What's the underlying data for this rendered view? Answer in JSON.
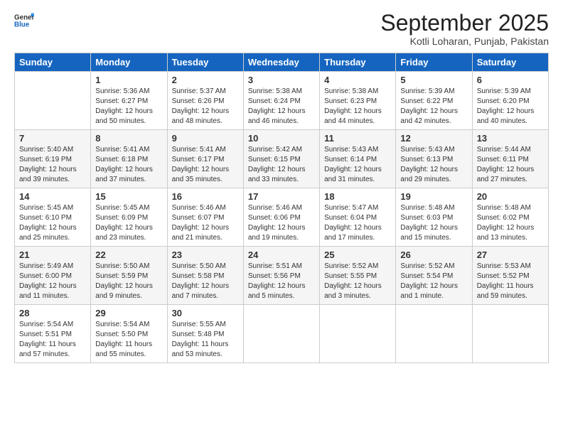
{
  "header": {
    "logo_general": "General",
    "logo_blue": "Blue",
    "month_year": "September 2025",
    "location": "Kotli Loharan, Punjab, Pakistan"
  },
  "weekdays": [
    "Sunday",
    "Monday",
    "Tuesday",
    "Wednesday",
    "Thursday",
    "Friday",
    "Saturday"
  ],
  "weeks": [
    [
      {
        "day": "",
        "info": ""
      },
      {
        "day": "1",
        "info": "Sunrise: 5:36 AM\nSunset: 6:27 PM\nDaylight: 12 hours\nand 50 minutes."
      },
      {
        "day": "2",
        "info": "Sunrise: 5:37 AM\nSunset: 6:26 PM\nDaylight: 12 hours\nand 48 minutes."
      },
      {
        "day": "3",
        "info": "Sunrise: 5:38 AM\nSunset: 6:24 PM\nDaylight: 12 hours\nand 46 minutes."
      },
      {
        "day": "4",
        "info": "Sunrise: 5:38 AM\nSunset: 6:23 PM\nDaylight: 12 hours\nand 44 minutes."
      },
      {
        "day": "5",
        "info": "Sunrise: 5:39 AM\nSunset: 6:22 PM\nDaylight: 12 hours\nand 42 minutes."
      },
      {
        "day": "6",
        "info": "Sunrise: 5:39 AM\nSunset: 6:20 PM\nDaylight: 12 hours\nand 40 minutes."
      }
    ],
    [
      {
        "day": "7",
        "info": "Sunrise: 5:40 AM\nSunset: 6:19 PM\nDaylight: 12 hours\nand 39 minutes."
      },
      {
        "day": "8",
        "info": "Sunrise: 5:41 AM\nSunset: 6:18 PM\nDaylight: 12 hours\nand 37 minutes."
      },
      {
        "day": "9",
        "info": "Sunrise: 5:41 AM\nSunset: 6:17 PM\nDaylight: 12 hours\nand 35 minutes."
      },
      {
        "day": "10",
        "info": "Sunrise: 5:42 AM\nSunset: 6:15 PM\nDaylight: 12 hours\nand 33 minutes."
      },
      {
        "day": "11",
        "info": "Sunrise: 5:43 AM\nSunset: 6:14 PM\nDaylight: 12 hours\nand 31 minutes."
      },
      {
        "day": "12",
        "info": "Sunrise: 5:43 AM\nSunset: 6:13 PM\nDaylight: 12 hours\nand 29 minutes."
      },
      {
        "day": "13",
        "info": "Sunrise: 5:44 AM\nSunset: 6:11 PM\nDaylight: 12 hours\nand 27 minutes."
      }
    ],
    [
      {
        "day": "14",
        "info": "Sunrise: 5:45 AM\nSunset: 6:10 PM\nDaylight: 12 hours\nand 25 minutes."
      },
      {
        "day": "15",
        "info": "Sunrise: 5:45 AM\nSunset: 6:09 PM\nDaylight: 12 hours\nand 23 minutes."
      },
      {
        "day": "16",
        "info": "Sunrise: 5:46 AM\nSunset: 6:07 PM\nDaylight: 12 hours\nand 21 minutes."
      },
      {
        "day": "17",
        "info": "Sunrise: 5:46 AM\nSunset: 6:06 PM\nDaylight: 12 hours\nand 19 minutes."
      },
      {
        "day": "18",
        "info": "Sunrise: 5:47 AM\nSunset: 6:04 PM\nDaylight: 12 hours\nand 17 minutes."
      },
      {
        "day": "19",
        "info": "Sunrise: 5:48 AM\nSunset: 6:03 PM\nDaylight: 12 hours\nand 15 minutes."
      },
      {
        "day": "20",
        "info": "Sunrise: 5:48 AM\nSunset: 6:02 PM\nDaylight: 12 hours\nand 13 minutes."
      }
    ],
    [
      {
        "day": "21",
        "info": "Sunrise: 5:49 AM\nSunset: 6:00 PM\nDaylight: 12 hours\nand 11 minutes."
      },
      {
        "day": "22",
        "info": "Sunrise: 5:50 AM\nSunset: 5:59 PM\nDaylight: 12 hours\nand 9 minutes."
      },
      {
        "day": "23",
        "info": "Sunrise: 5:50 AM\nSunset: 5:58 PM\nDaylight: 12 hours\nand 7 minutes."
      },
      {
        "day": "24",
        "info": "Sunrise: 5:51 AM\nSunset: 5:56 PM\nDaylight: 12 hours\nand 5 minutes."
      },
      {
        "day": "25",
        "info": "Sunrise: 5:52 AM\nSunset: 5:55 PM\nDaylight: 12 hours\nand 3 minutes."
      },
      {
        "day": "26",
        "info": "Sunrise: 5:52 AM\nSunset: 5:54 PM\nDaylight: 12 hours\nand 1 minute."
      },
      {
        "day": "27",
        "info": "Sunrise: 5:53 AM\nSunset: 5:52 PM\nDaylight: 11 hours\nand 59 minutes."
      }
    ],
    [
      {
        "day": "28",
        "info": "Sunrise: 5:54 AM\nSunset: 5:51 PM\nDaylight: 11 hours\nand 57 minutes."
      },
      {
        "day": "29",
        "info": "Sunrise: 5:54 AM\nSunset: 5:50 PM\nDaylight: 11 hours\nand 55 minutes."
      },
      {
        "day": "30",
        "info": "Sunrise: 5:55 AM\nSunset: 5:48 PM\nDaylight: 11 hours\nand 53 minutes."
      },
      {
        "day": "",
        "info": ""
      },
      {
        "day": "",
        "info": ""
      },
      {
        "day": "",
        "info": ""
      },
      {
        "day": "",
        "info": ""
      }
    ]
  ]
}
